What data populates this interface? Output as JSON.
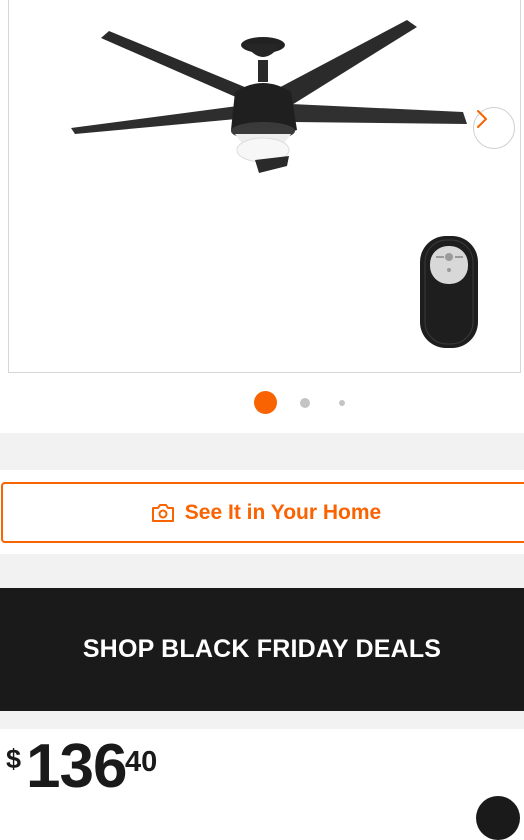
{
  "gallery": {
    "next_icon": "chevron-right-icon",
    "dots": 3,
    "active_dot": 1,
    "accent": "#f96302"
  },
  "ar_button": {
    "label": "See It in Your Home",
    "icon": "camera-icon",
    "color": "#f96302"
  },
  "promo_banner": {
    "label": "SHOP BLACK FRIDAY DEALS",
    "background": "#1a1a1a"
  },
  "price": {
    "currency": "$",
    "dollars": "136",
    "cents": "40"
  }
}
